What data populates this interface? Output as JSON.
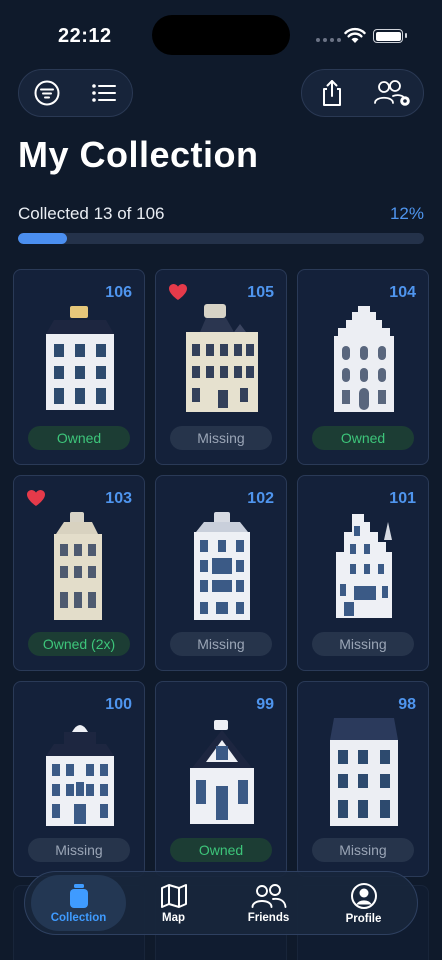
{
  "status_bar": {
    "time": "22:12"
  },
  "page": {
    "title": "My Collection"
  },
  "progress": {
    "label": "Collected 13 of 106",
    "percent_label": "12%",
    "fraction": 0.12
  },
  "colors": {
    "accent": "#4f95ee",
    "owned": "#3dc57a",
    "missing": "#9aa5b6",
    "heart": "#e53a4a",
    "background": "#0f1a2b"
  },
  "toolbar": {
    "left": [
      {
        "icon": "filter-icon"
      },
      {
        "icon": "list-icon"
      }
    ],
    "right": [
      {
        "icon": "share-icon"
      },
      {
        "icon": "friends-settings-icon"
      }
    ]
  },
  "cards": [
    {
      "number": "106",
      "status": "Owned",
      "owned": true,
      "favorite": false
    },
    {
      "number": "105",
      "status": "Missing",
      "owned": false,
      "favorite": true
    },
    {
      "number": "104",
      "status": "Owned",
      "owned": true,
      "favorite": false
    },
    {
      "number": "103",
      "status": "Owned (2x)",
      "owned": true,
      "favorite": true
    },
    {
      "number": "102",
      "status": "Missing",
      "owned": false,
      "favorite": false
    },
    {
      "number": "101",
      "status": "Missing",
      "owned": false,
      "favorite": false
    },
    {
      "number": "100",
      "status": "Missing",
      "owned": false,
      "favorite": false
    },
    {
      "number": "99",
      "status": "Owned",
      "owned": true,
      "favorite": false
    },
    {
      "number": "98",
      "status": "Missing",
      "owned": false,
      "favorite": false
    }
  ],
  "tabbar": {
    "tabs": [
      {
        "label": "Collection",
        "icon": "jar-icon",
        "active": true
      },
      {
        "label": "Map",
        "icon": "map-icon",
        "active": false
      },
      {
        "label": "Friends",
        "icon": "people-icon",
        "active": false
      },
      {
        "label": "Profile",
        "icon": "profile-icon",
        "active": false
      }
    ]
  }
}
